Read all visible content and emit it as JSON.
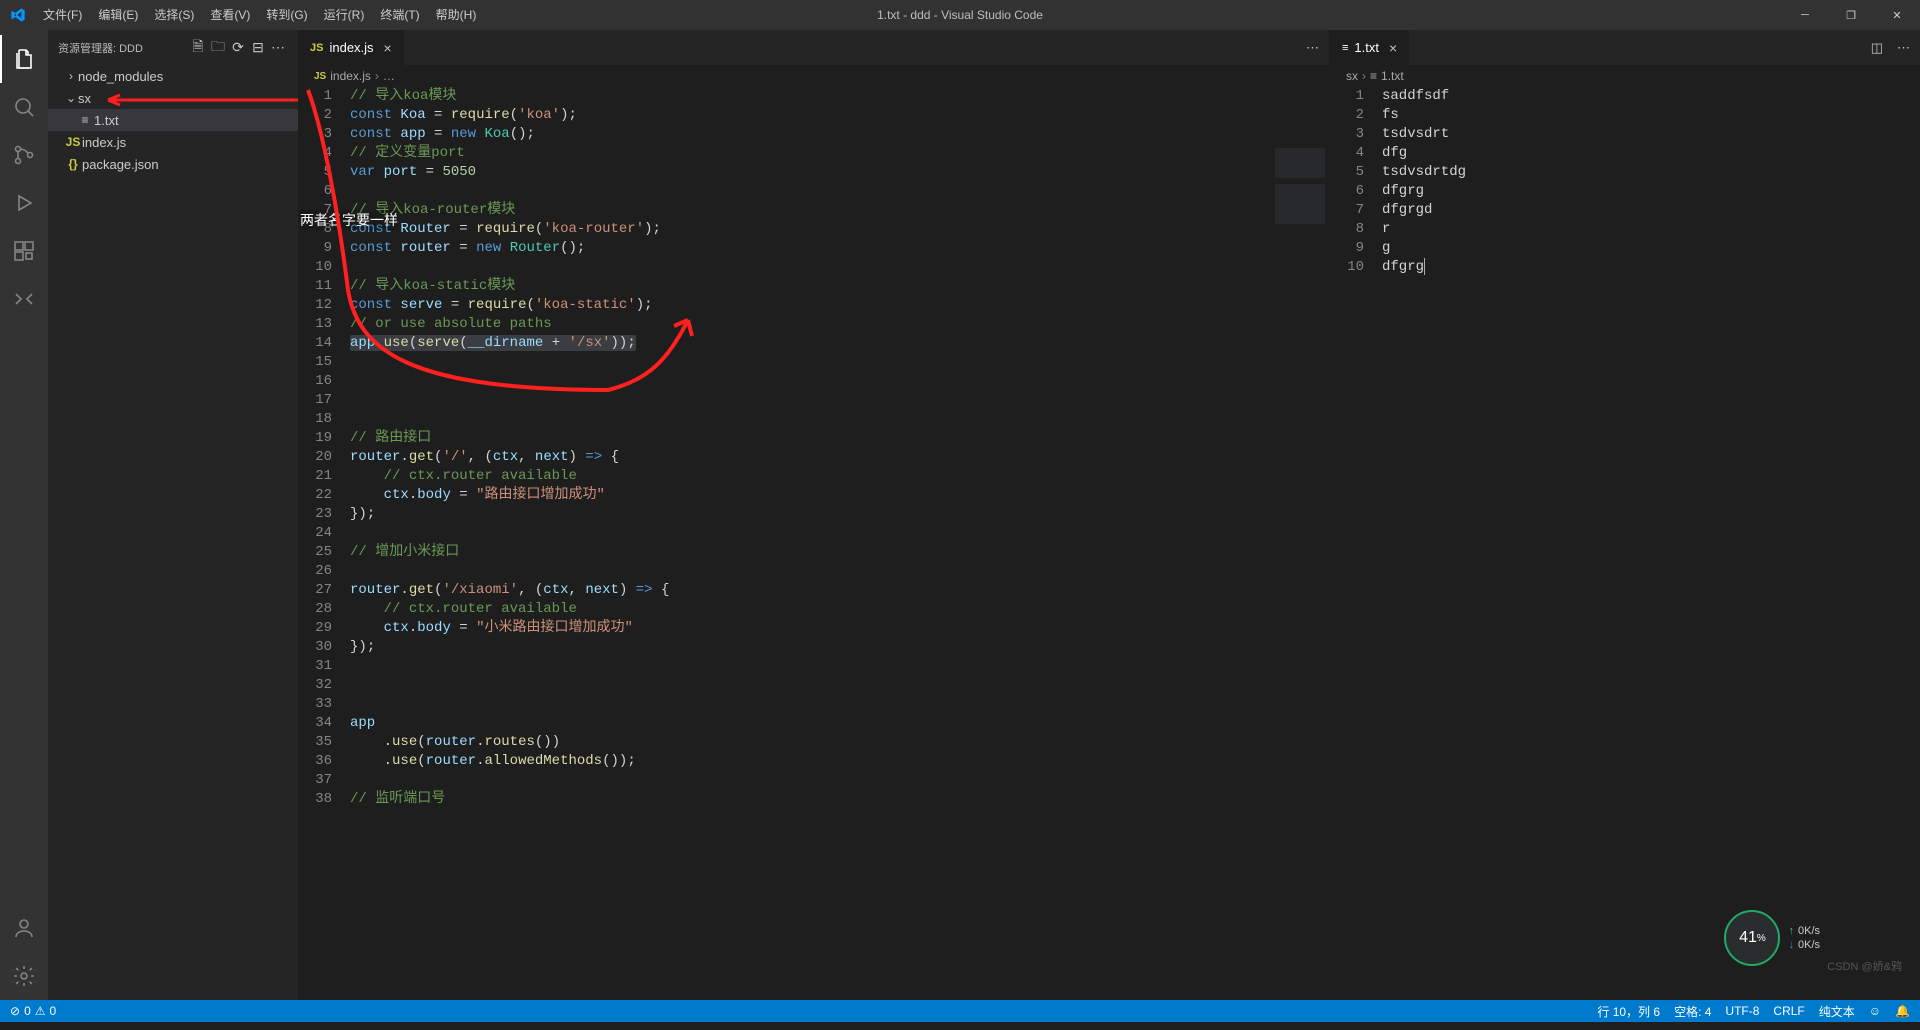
{
  "window": {
    "title": "1.txt - ddd - Visual Studio Code"
  },
  "menu": [
    "文件(F)",
    "编辑(E)",
    "选择(S)",
    "查看(V)",
    "转到(G)",
    "运行(R)",
    "终端(T)",
    "帮助(H)"
  ],
  "explorer": {
    "title": "资源管理器: DDD",
    "tree": {
      "node_modules": "node_modules",
      "sx": "sx",
      "file_txt": "1.txt",
      "index_js": "index.js",
      "package_json": "package.json"
    }
  },
  "editor1": {
    "tab_label": "index.js",
    "breadcrumb": [
      "index.js",
      "…"
    ],
    "lines": [
      {
        "n": 1,
        "html": "<span class='c-comment'>// 导入koa模块</span>"
      },
      {
        "n": 2,
        "html": "<span class='c-keyword'>const</span> <span class='c-var'>Koa</span> <span class='c-op'>=</span> <span class='c-func'>require</span><span class='c-paren'>(</span><span class='c-str'>'koa'</span><span class='c-paren'>)</span>;"
      },
      {
        "n": 3,
        "html": "<span class='c-keyword'>const</span> <span class='c-var'>app</span> <span class='c-op'>=</span> <span class='c-keyword'>new</span> <span class='c-type'>Koa</span><span class='c-paren'>()</span>;"
      },
      {
        "n": 4,
        "html": "<span class='c-comment'>// 定义变量port</span>"
      },
      {
        "n": 5,
        "html": "<span class='c-keyword'>var</span> <span class='c-var'>port</span> <span class='c-op'>=</span> <span class='c-num'>5050</span>"
      },
      {
        "n": 6,
        "html": ""
      },
      {
        "n": 7,
        "html": "<span class='c-comment'>// 导入koa-router模块</span>"
      },
      {
        "n": 8,
        "html": "<span class='c-keyword'>const</span> <span class='c-var'>Router</span> <span class='c-op'>=</span> <span class='c-func'>require</span><span class='c-paren'>(</span><span class='c-str'>'koa-router'</span><span class='c-paren'>)</span>;"
      },
      {
        "n": 9,
        "html": "<span class='c-keyword'>const</span> <span class='c-var'>router</span> <span class='c-op'>=</span> <span class='c-keyword'>new</span> <span class='c-type'>Router</span><span class='c-paren'>()</span>;"
      },
      {
        "n": 10,
        "html": ""
      },
      {
        "n": 11,
        "html": "<span class='c-comment'>// 导入koa-static模块</span>"
      },
      {
        "n": 12,
        "html": "<span class='c-keyword'>const</span> <span class='c-var'>serve</span> <span class='c-op'>=</span> <span class='c-func'>require</span><span class='c-paren'>(</span><span class='c-str'>'koa-static'</span><span class='c-paren'>)</span>;"
      },
      {
        "n": 13,
        "html": "<span class='c-comment'>// or use absolute paths</span>"
      },
      {
        "n": 14,
        "html": "<span class='c-hl'><span class='c-var'>app</span>.<span class='c-func'>use</span><span class='c-paren'>(</span><span class='c-func'>serve</span><span class='c-paren'>(</span><span class='c-var'>__dirname</span> <span class='c-op'>+</span> <span class='c-str'>'/sx'</span><span class='c-paren'>))</span>;</span>"
      },
      {
        "n": 15,
        "html": ""
      },
      {
        "n": 16,
        "html": ""
      },
      {
        "n": 17,
        "html": ""
      },
      {
        "n": 18,
        "html": ""
      },
      {
        "n": 19,
        "html": "<span class='c-comment'>// 路由接口</span>"
      },
      {
        "n": 20,
        "html": "<span class='c-var'>router</span>.<span class='c-func'>get</span><span class='c-paren'>(</span><span class='c-str'>'/'</span>, <span class='c-paren'>(</span><span class='c-var'>ctx</span>, <span class='c-var'>next</span><span class='c-paren'>)</span> <span class='c-keyword'>=&gt;</span> <span class='c-paren'>{</span>"
      },
      {
        "n": 21,
        "html": "    <span class='c-comment'>// ctx.router available</span>"
      },
      {
        "n": 22,
        "html": "    <span class='c-var'>ctx</span>.<span class='c-var'>body</span> <span class='c-op'>=</span> <span class='c-str'>\"路由接口增加成功\"</span>"
      },
      {
        "n": 23,
        "html": "<span class='c-paren'>})</span>;"
      },
      {
        "n": 24,
        "html": ""
      },
      {
        "n": 25,
        "html": "<span class='c-comment'>// 增加小米接口</span>"
      },
      {
        "n": 26,
        "html": ""
      },
      {
        "n": 27,
        "html": "<span class='c-var'>router</span>.<span class='c-func'>get</span><span class='c-paren'>(</span><span class='c-str'>'/xiaomi'</span>, <span class='c-paren'>(</span><span class='c-var'>ctx</span>, <span class='c-var'>next</span><span class='c-paren'>)</span> <span class='c-keyword'>=&gt;</span> <span class='c-paren'>{</span>"
      },
      {
        "n": 28,
        "html": "    <span class='c-comment'>// ctx.router available</span>"
      },
      {
        "n": 29,
        "html": "    <span class='c-var'>ctx</span>.<span class='c-var'>body</span> <span class='c-op'>=</span> <span class='c-str'>\"小米路由接口增加成功\"</span>"
      },
      {
        "n": 30,
        "html": "<span class='c-paren'>})</span>;"
      },
      {
        "n": 31,
        "html": ""
      },
      {
        "n": 32,
        "html": ""
      },
      {
        "n": 33,
        "html": ""
      },
      {
        "n": 34,
        "html": "<span class='c-var'>app</span>"
      },
      {
        "n": 35,
        "html": "    .<span class='c-func'>use</span><span class='c-paren'>(</span><span class='c-var'>router</span>.<span class='c-func'>routes</span><span class='c-paren'>())</span>"
      },
      {
        "n": 36,
        "html": "    .<span class='c-func'>use</span><span class='c-paren'>(</span><span class='c-var'>router</span>.<span class='c-func'>allowedMethods</span><span class='c-paren'>())</span>;"
      },
      {
        "n": 37,
        "html": ""
      },
      {
        "n": 38,
        "html": "<span class='c-comment'>// 监听端口号</span>"
      }
    ]
  },
  "editor2": {
    "tab_label": "1.txt",
    "breadcrumb_root": "sx",
    "breadcrumb_file": "1.txt",
    "lines": [
      {
        "n": 1,
        "t": "saddfsdf"
      },
      {
        "n": 2,
        "t": "fs"
      },
      {
        "n": 3,
        "t": "tsdvsdrt"
      },
      {
        "n": 4,
        "t": "dfg"
      },
      {
        "n": 5,
        "t": "tsdvsdrtdg"
      },
      {
        "n": 6,
        "t": "dfgrg"
      },
      {
        "n": 7,
        "t": "dfgrgd"
      },
      {
        "n": 8,
        "t": "r"
      },
      {
        "n": 9,
        "t": "g"
      },
      {
        "n": 10,
        "t": "dfgrg"
      }
    ]
  },
  "status": {
    "errors": "0",
    "warnings": "0",
    "pos": "行 10，列 6",
    "spaces": "空格: 4",
    "encoding": "UTF-8",
    "eol": "CRLF",
    "lang": "纯文本"
  },
  "annotation": {
    "text": "两者名字要一样"
  },
  "net": {
    "pct": "41",
    "unit": "%",
    "up": "0K/s",
    "down": "0K/s"
  },
  "watermark": "CSDN @娇&鸦"
}
